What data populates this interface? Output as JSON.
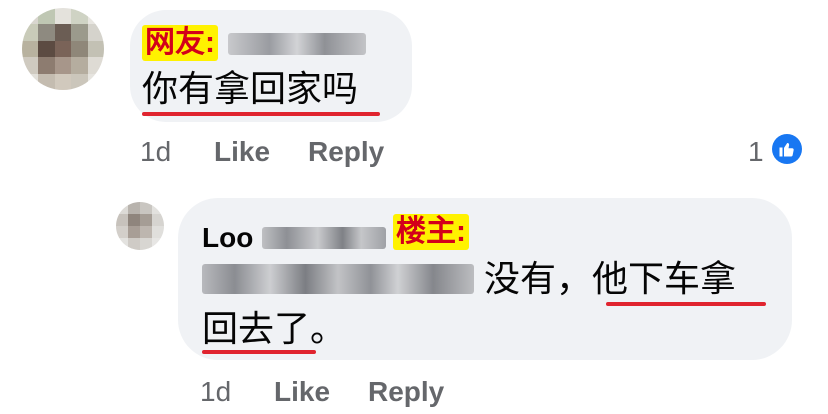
{
  "comment1": {
    "tag_label": "网友:",
    "text": "你有拿回家吗",
    "time": "1d",
    "like_label": "Like",
    "reply_label": "Reply",
    "reaction_count": "1",
    "reaction_icon": "thumbs-up-icon"
  },
  "comment2": {
    "author_first": "Loo",
    "tag_label": "楼主:",
    "text_line1": "没有，他下车拿",
    "text_line2": "回去了。",
    "time": "1d",
    "like_label": "Like",
    "reply_label": "Reply"
  },
  "colors": {
    "bubble": "#f0f2f5",
    "tag_bg": "#fff200",
    "tag_text": "#d3001a",
    "underline": "#e0242f",
    "like_blue": "#1877f2",
    "meta_gray": "#65676b"
  }
}
